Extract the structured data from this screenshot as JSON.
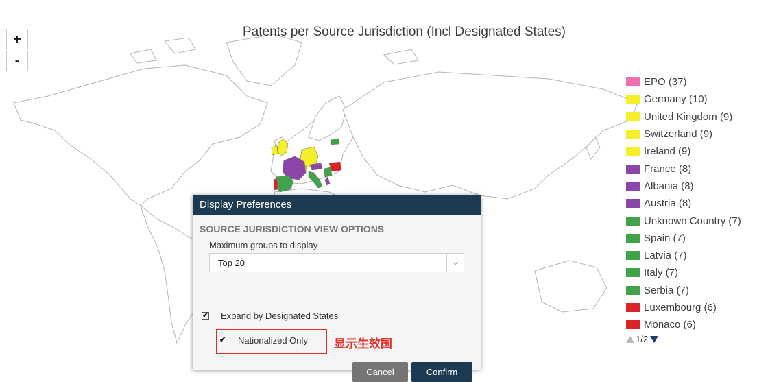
{
  "chart": {
    "title": "Patents per Source Jurisdiction (Incl Designated States)"
  },
  "zoom": {
    "in_label": "+",
    "out_label": "-"
  },
  "legend": {
    "items": [
      {
        "label": "EPO (37)",
        "color": "#ee6fb2"
      },
      {
        "label": "Germany (10)",
        "color": "#f5ef2a"
      },
      {
        "label": "United Kingdom (9)",
        "color": "#f5ef2a"
      },
      {
        "label": "Switzerland (9)",
        "color": "#f5ef2a"
      },
      {
        "label": "Ireland (9)",
        "color": "#f5ef2a"
      },
      {
        "label": "France (8)",
        "color": "#8c45a8"
      },
      {
        "label": "Albania (8)",
        "color": "#8c45a8"
      },
      {
        "label": "Austria (8)",
        "color": "#8c45a8"
      },
      {
        "label": "Unknown Country (7)",
        "color": "#3fa34a"
      },
      {
        "label": "Spain (7)",
        "color": "#3fa34a"
      },
      {
        "label": "Latvia (7)",
        "color": "#3fa34a"
      },
      {
        "label": "Italy (7)",
        "color": "#3fa34a"
      },
      {
        "label": "Serbia (7)",
        "color": "#3fa34a"
      },
      {
        "label": "Luxembourg (6)",
        "color": "#dd2226"
      },
      {
        "label": "Monaco (6)",
        "color": "#dd2226"
      }
    ],
    "page": "1/2"
  },
  "dialog": {
    "title": "Display Preferences",
    "section_title": "SOURCE JURISDICTION VIEW OPTIONS",
    "max_groups_label": "Maximum groups to display",
    "max_groups_value": "Top 20",
    "expand_label": "Expand by Designated States",
    "expand_checked": true,
    "nationalized_label": "Nationalized Only",
    "nationalized_checked": true,
    "cancel_label": "Cancel",
    "confirm_label": "Confirm"
  },
  "annotation": {
    "text": "显示生效国"
  }
}
